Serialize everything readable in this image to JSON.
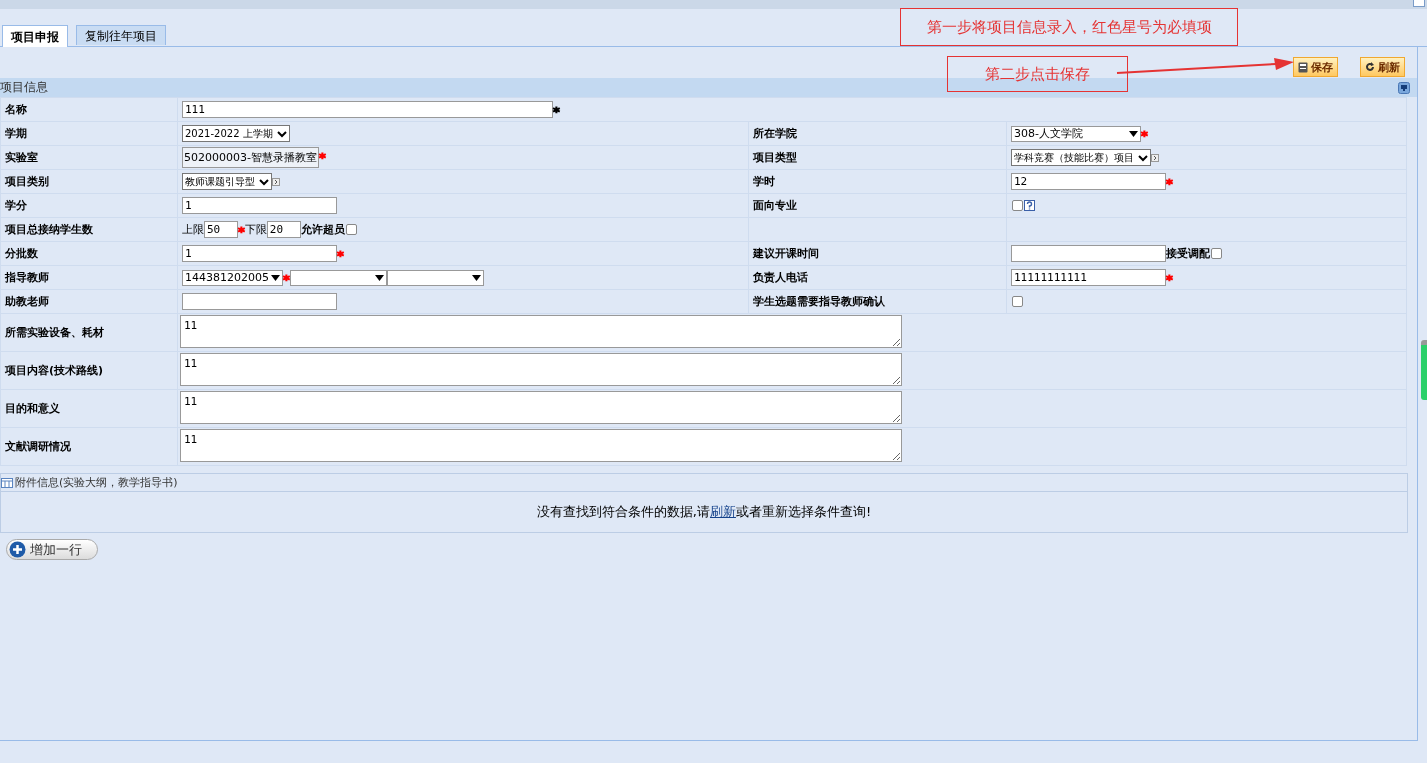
{
  "tabs": [
    {
      "label": "项目申报",
      "selected": true
    },
    {
      "label": "复制往年项目",
      "selected": false
    }
  ],
  "toolbar": [
    {
      "kind": "save",
      "label": "保存"
    },
    {
      "kind": "refresh",
      "label": "刷新"
    }
  ],
  "annotations": [
    {
      "kind": "box",
      "text": "第一步将项目信息录入，红色星号为必填项"
    },
    {
      "kind": "arrow-box",
      "text": "第二步点击保存"
    }
  ],
  "section": {
    "title": "项目信息"
  },
  "rows": [
    {
      "full_width": true,
      "left": {
        "label": "名称",
        "controls": [
          {
            "kind": "text",
            "value": "111"
          },
          {
            "kind": "star",
            "text": "*",
            "color": "#000000"
          }
        ]
      }
    },
    {
      "left": {
        "label": "学期",
        "controls": [
          {
            "kind": "select",
            "value": "2021-2022 上学期"
          }
        ]
      },
      "right": {
        "label": "所在学院",
        "controls": [
          {
            "kind": "combo",
            "value": "308-人文学院"
          },
          {
            "kind": "star",
            "text": "*",
            "color": "#ff0000"
          }
        ]
      }
    },
    {
      "left": {
        "label": "实验室",
        "controls": [
          {
            "kind": "readonly",
            "value": "502000003-智慧录播教室"
          },
          {
            "kind": "star",
            "text": "*",
            "color": "#ff0000"
          }
        ]
      },
      "right": {
        "label": "项目类型",
        "controls": [
          {
            "kind": "select",
            "value": "学科竞赛（技能比赛）项目"
          },
          {
            "kind": "picker"
          }
        ]
      }
    },
    {
      "left": {
        "label": "项目类别",
        "controls": [
          {
            "kind": "select",
            "value": "教师课题引导型"
          },
          {
            "kind": "picker"
          }
        ]
      },
      "right": {
        "label": "学时",
        "controls": [
          {
            "kind": "text",
            "value": "12"
          },
          {
            "kind": "star",
            "text": "*",
            "color": "#ff0000"
          }
        ]
      }
    },
    {
      "left": {
        "label": "学分",
        "controls": [
          {
            "kind": "text",
            "value": "1"
          }
        ]
      },
      "right": {
        "label": "面向专业",
        "controls": [
          {
            "kind": "checkbox",
            "checked": false
          },
          {
            "kind": "help"
          }
        ]
      }
    },
    {
      "left": {
        "label": "项目总接纳学生数",
        "controls": [
          {
            "kind": "caption",
            "text": "上限"
          },
          {
            "kind": "short-text",
            "value": "50"
          },
          {
            "kind": "star",
            "text": "*",
            "color": "#ff0000"
          },
          {
            "kind": "caption",
            "text": "下限"
          },
          {
            "kind": "short-text",
            "value": "20"
          },
          {
            "kind": "caption",
            "text": "允许超员"
          },
          {
            "kind": "checkbox",
            "checked": false
          }
        ]
      }
    },
    {
      "left": {
        "label": "分批数",
        "controls": [
          {
            "kind": "text",
            "value": "1"
          },
          {
            "kind": "star",
            "text": "*",
            "color": "#ff0000"
          }
        ]
      },
      "right": {
        "label": "建议开课时间",
        "controls": [
          {
            "kind": "text"
          },
          {
            "kind": "caption",
            "text": "接受调配"
          },
          {
            "kind": "checkbox",
            "checked": false
          }
        ]
      }
    },
    {
      "left": {
        "label": "指导教师",
        "controls": [
          {
            "kind": "combo",
            "value": "144381202005"
          },
          {
            "kind": "star",
            "text": "*",
            "color": "#ff0000"
          },
          {
            "kind": "combo"
          },
          {
            "kind": "combo"
          }
        ]
      },
      "right": {
        "label": "负责人电话",
        "controls": [
          {
            "kind": "text",
            "value": "11111111111"
          },
          {
            "kind": "star",
            "text": "*",
            "color": "#ff0000"
          }
        ]
      }
    },
    {
      "left": {
        "label": "助教老师",
        "controls": [
          {
            "kind": "text"
          }
        ]
      },
      "right": {
        "label": "学生选题需要指导教师确认",
        "controls": [
          {
            "kind": "checkbox",
            "checked": false
          }
        ]
      }
    }
  ],
  "text_areas": [
    {
      "label": "所需实验设备、耗材",
      "value": "11"
    },
    {
      "label": "项目内容(技术路线)",
      "value": "11"
    },
    {
      "label": "目的和意义",
      "value": "11"
    },
    {
      "label": "文献调研情况",
      "value": "11"
    }
  ],
  "attachments": {
    "title": "附件信息(实验大纲，教学指导书)",
    "message_before": "没有查找到符合条件的数据,请",
    "link": "刷新",
    "message_after": "或者重新选择条件查询!"
  },
  "add_row_button": {
    "label": "增加一行"
  }
}
